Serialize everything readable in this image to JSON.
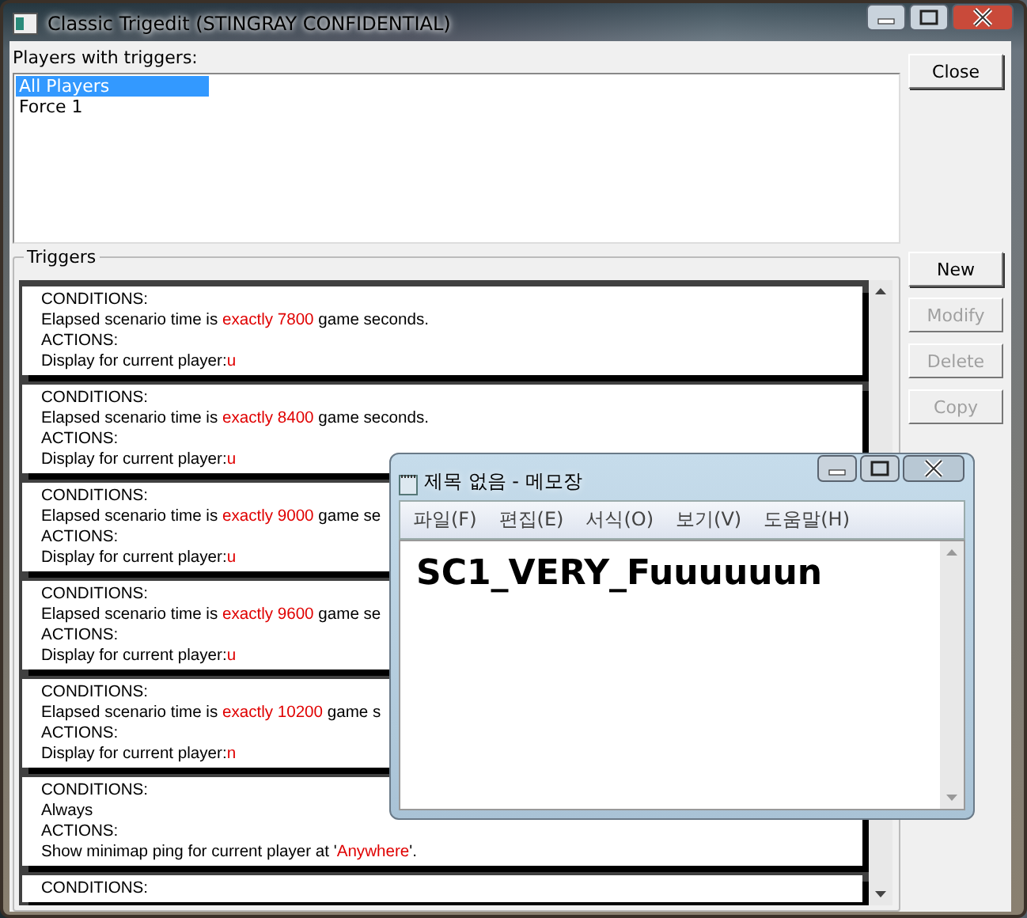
{
  "window": {
    "title": "Classic Trigedit (STINGRAY CONFIDENTIAL)"
  },
  "players": {
    "label": "Players with triggers:",
    "items": [
      {
        "label": "All Players",
        "selected": true
      },
      {
        "label": "Force 1",
        "selected": false
      }
    ]
  },
  "close_button": "Close",
  "triggers": {
    "label": "Triggers",
    "items": [
      {
        "lines": [
          [
            {
              "kind": "plain",
              "text": "CONDITIONS:"
            }
          ],
          [
            {
              "kind": "plain",
              "text": "Elapsed scenario time is "
            },
            {
              "kind": "value",
              "text": "exactly 7800"
            },
            {
              "kind": "plain",
              "text": " game seconds."
            }
          ],
          [
            {
              "kind": "plain",
              "text": "ACTIONS:"
            }
          ],
          [
            {
              "kind": "plain",
              "text": "Display for current player:"
            },
            {
              "kind": "value",
              "text": "u"
            }
          ]
        ]
      },
      {
        "lines": [
          [
            {
              "kind": "plain",
              "text": "CONDITIONS:"
            }
          ],
          [
            {
              "kind": "plain",
              "text": "Elapsed scenario time is "
            },
            {
              "kind": "value",
              "text": "exactly 8400"
            },
            {
              "kind": "plain",
              "text": " game seconds."
            }
          ],
          [
            {
              "kind": "plain",
              "text": "ACTIONS:"
            }
          ],
          [
            {
              "kind": "plain",
              "text": "Display for current player:"
            },
            {
              "kind": "value",
              "text": "u"
            }
          ]
        ]
      },
      {
        "lines": [
          [
            {
              "kind": "plain",
              "text": "CONDITIONS:"
            }
          ],
          [
            {
              "kind": "plain",
              "text": "Elapsed scenario time is "
            },
            {
              "kind": "value",
              "text": "exactly 9000"
            },
            {
              "kind": "plain",
              "text": " game se"
            }
          ],
          [
            {
              "kind": "plain",
              "text": "ACTIONS:"
            }
          ],
          [
            {
              "kind": "plain",
              "text": "Display for current player:"
            },
            {
              "kind": "value",
              "text": "u"
            }
          ]
        ]
      },
      {
        "lines": [
          [
            {
              "kind": "plain",
              "text": "CONDITIONS:"
            }
          ],
          [
            {
              "kind": "plain",
              "text": "Elapsed scenario time is "
            },
            {
              "kind": "value",
              "text": "exactly 9600"
            },
            {
              "kind": "plain",
              "text": " game se"
            }
          ],
          [
            {
              "kind": "plain",
              "text": "ACTIONS:"
            }
          ],
          [
            {
              "kind": "plain",
              "text": "Display for current player:"
            },
            {
              "kind": "value",
              "text": "u"
            }
          ]
        ]
      },
      {
        "lines": [
          [
            {
              "kind": "plain",
              "text": "CONDITIONS:"
            }
          ],
          [
            {
              "kind": "plain",
              "text": "Elapsed scenario time is "
            },
            {
              "kind": "value",
              "text": "exactly 10200"
            },
            {
              "kind": "plain",
              "text": " game s"
            }
          ],
          [
            {
              "kind": "plain",
              "text": "ACTIONS:"
            }
          ],
          [
            {
              "kind": "plain",
              "text": "Display for current player:"
            },
            {
              "kind": "value",
              "text": "n"
            }
          ]
        ]
      },
      {
        "lines": [
          [
            {
              "kind": "plain",
              "text": "CONDITIONS:"
            }
          ],
          [
            {
              "kind": "plain",
              "text": "Always"
            }
          ],
          [
            {
              "kind": "plain",
              "text": "ACTIONS:"
            }
          ],
          [
            {
              "kind": "plain",
              "text": "Show minimap ping for current player at '"
            },
            {
              "kind": "value",
              "text": "Anywhere"
            },
            {
              "kind": "plain",
              "text": "'."
            }
          ]
        ]
      },
      {
        "lines": [
          [
            {
              "kind": "plain",
              "text": "CONDITIONS:"
            }
          ]
        ]
      }
    ]
  },
  "buttons": [
    {
      "label": "New",
      "disabled": false
    },
    {
      "label": "Modify",
      "disabled": true
    },
    {
      "label": "Delete",
      "disabled": true
    },
    {
      "label": "Copy",
      "disabled": true
    }
  ],
  "notepad": {
    "title": "제목 없음 - 메모장",
    "menu": [
      "파일(F)",
      "편집(E)",
      "서식(O)",
      "보기(V)",
      "도움말(H)"
    ],
    "content": "SC1_VERY_Fuuuuuun"
  }
}
